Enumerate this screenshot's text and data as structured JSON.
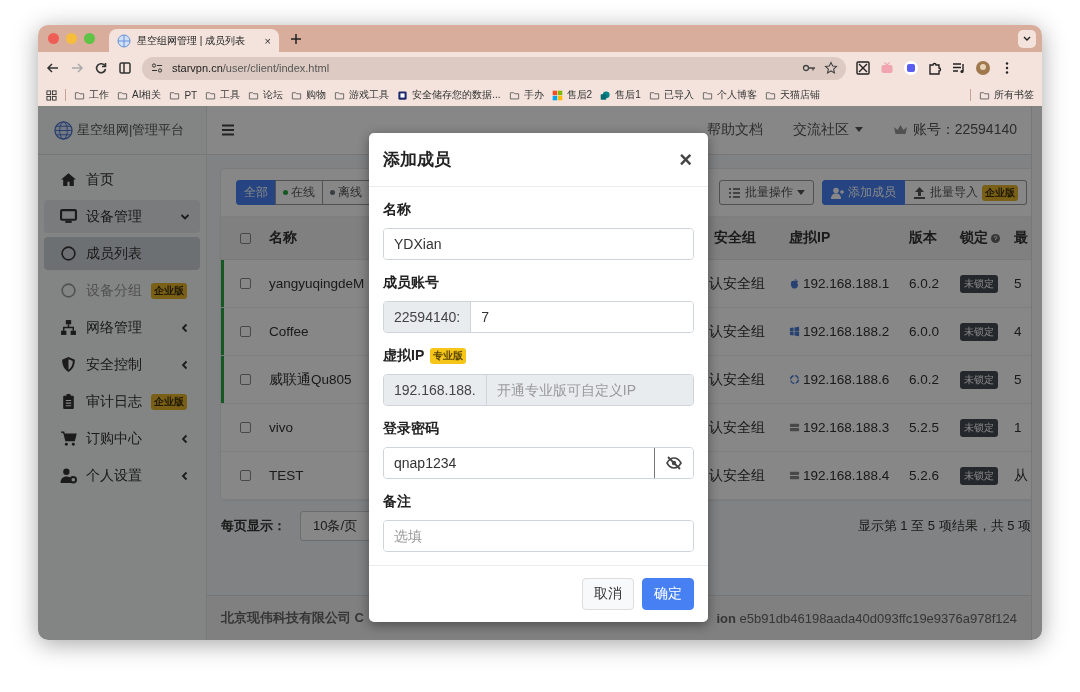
{
  "browser": {
    "tab_title": "星空组网管理 | 成员列表",
    "tab_close": "×",
    "url_host": "starvpn.cn",
    "url_path": "/user/client/index.html",
    "all_bookmarks": "所有书签",
    "bookmarks": [
      {
        "label": "工作",
        "kind": "folder"
      },
      {
        "label": "AI相关",
        "kind": "folder"
      },
      {
        "label": "PT",
        "kind": "folder"
      },
      {
        "label": "工具",
        "kind": "folder"
      },
      {
        "label": "论坛",
        "kind": "folder"
      },
      {
        "label": "购物",
        "kind": "folder"
      },
      {
        "label": "游戏工具",
        "kind": "folder"
      },
      {
        "label": "安全储存您的数据...",
        "kind": "vault"
      },
      {
        "label": "手办",
        "kind": "folder"
      },
      {
        "label": "售后2",
        "kind": "tiles"
      },
      {
        "label": "售后1",
        "kind": "cloud"
      },
      {
        "label": "已导入",
        "kind": "folder"
      },
      {
        "label": "个人博客",
        "kind": "folder"
      },
      {
        "label": "天猫店铺",
        "kind": "folder"
      }
    ]
  },
  "brand": "星空组网|管理平台",
  "top_nav": [
    {
      "label": "帮助文档",
      "dropdown": false
    },
    {
      "label": "交流社区",
      "dropdown": true
    }
  ],
  "account": "账号：22594140",
  "sidebar": {
    "items": [
      {
        "label": "首页",
        "selected": false,
        "disabled": false
      },
      {
        "label": "设备管理",
        "selected": false,
        "disabled": false,
        "expanded": true,
        "children": [
          {
            "label": "成员列表",
            "selected": true,
            "disabled": false
          },
          {
            "label": "设备分组",
            "selected": false,
            "disabled": true,
            "badge": "企业版"
          }
        ]
      },
      {
        "label": "网络管理",
        "selected": false,
        "disabled": false,
        "expanded": false
      },
      {
        "label": "安全控制",
        "selected": false,
        "disabled": false,
        "expanded": false
      },
      {
        "label": "审计日志",
        "selected": false,
        "disabled": false,
        "badge": "企业版"
      },
      {
        "label": "订购中心",
        "selected": false,
        "disabled": false,
        "expanded": false
      },
      {
        "label": "个人设置",
        "selected": false,
        "disabled": false,
        "expanded": false
      }
    ]
  },
  "filters": [
    {
      "label": "全部",
      "selected": true,
      "kind": "all"
    },
    {
      "label": "在线",
      "selected": false,
      "kind": "online"
    },
    {
      "label": "离线",
      "selected": false,
      "kind": "offline"
    }
  ],
  "toolbar": {
    "batch": "批量操作",
    "add": "添加成员",
    "import": "批量导入",
    "import_badge": "企业版"
  },
  "table": {
    "all_checked": false,
    "columns": [
      "名称",
      "安全组",
      "虚拟IP",
      "版本",
      "锁定",
      "最"
    ],
    "rows": [
      {
        "name": "yangyuqingdeM",
        "checked": false,
        "online": true,
        "group": "认安全组",
        "kind": "apple",
        "ip": "192.168.188.1",
        "version": "6.0.2",
        "lock": "未锁定",
        "column_8": "5"
      },
      {
        "name": "Coffee",
        "checked": false,
        "online": true,
        "group": "认安全组",
        "kind": "windows",
        "ip": "192.168.188.2",
        "version": "6.0.0",
        "lock": "未锁定",
        "column_8": "4"
      },
      {
        "name": "威联通Qu805",
        "checked": false,
        "online": true,
        "group": "认安全组",
        "kind": "ring",
        "ip": "192.168.188.6",
        "version": "6.0.2",
        "lock": "未锁定",
        "column_8": "5"
      },
      {
        "name": "vivo",
        "checked": false,
        "online": false,
        "group": "认安全组",
        "kind": "server",
        "ip": "192.168.188.3",
        "version": "5.2.5",
        "lock": "未锁定",
        "column_8": "1"
      },
      {
        "name": "TEST",
        "checked": false,
        "online": false,
        "group": "认安全组",
        "kind": "server",
        "ip": "192.168.188.4",
        "version": "5.2.6",
        "lock": "未锁定",
        "column_8": "从"
      }
    ]
  },
  "pagination": {
    "per_page_label": "每页显示：",
    "per_page": "10条/页",
    "summary": "显示第 1 至 5 项结果，共 5 项"
  },
  "footer": {
    "company": "北京现伟科技有限公司 C",
    "version": "**ion** e5b91db46198aada40d093ffc19e9376a978f124"
  },
  "modal": {
    "title": "添加成员",
    "close": "×",
    "cancel": "取消",
    "ok": "确定",
    "fields": [
      {
        "kind": "text",
        "label": "名称",
        "value": "YDXian",
        "disabled": false
      },
      {
        "kind": "prefixed",
        "label": "成员账号",
        "prefix": "22594140:",
        "value": "7",
        "disabled": false
      },
      {
        "kind": "prefixed",
        "label": "虚拟IP",
        "badge": "专业版",
        "prefix": "192.168.188.",
        "placeholder": "开通专业版可自定义IP",
        "disabled": true
      },
      {
        "kind": "password",
        "label": "登录密码",
        "value": "qnap1234",
        "disabled": false
      },
      {
        "kind": "text",
        "label": "备注",
        "placeholder": "选填",
        "disabled": false
      }
    ]
  }
}
